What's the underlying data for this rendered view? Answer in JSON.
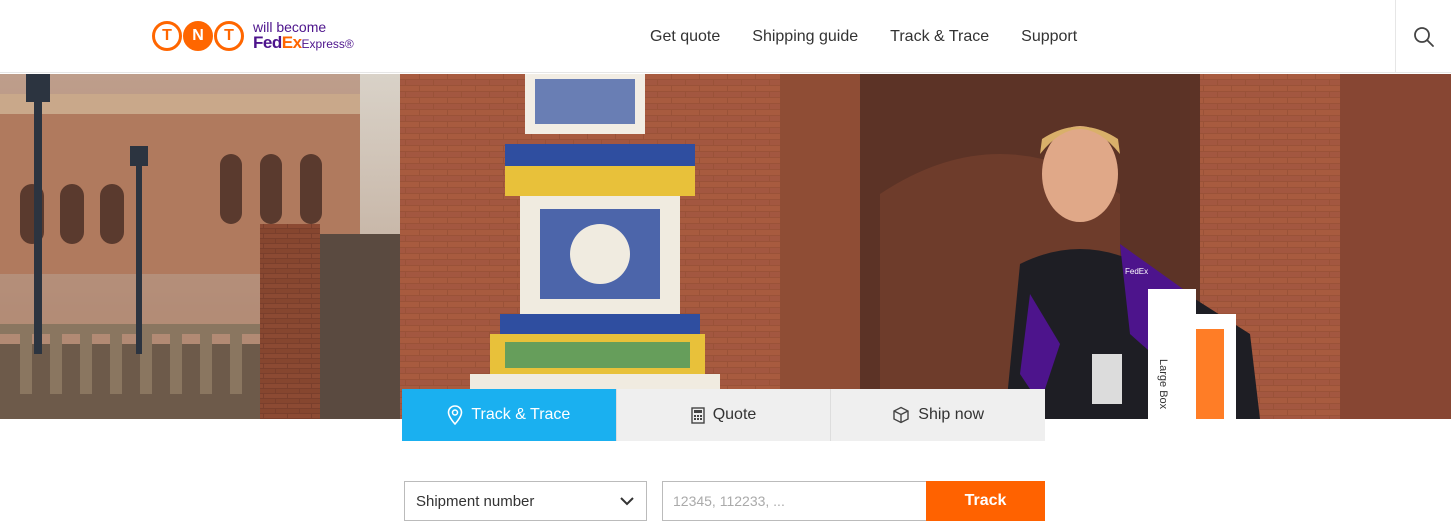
{
  "brand": {
    "tnt_letters": [
      "T",
      "N",
      "T"
    ],
    "tagline": "will become",
    "fedex_fed": "Fed",
    "fedex_ex": "Ex",
    "fedex_suffix": "Express",
    "reg": "®"
  },
  "nav": {
    "items": [
      {
        "label": "Get quote"
      },
      {
        "label": "Shipping guide"
      },
      {
        "label": "Track & Trace"
      },
      {
        "label": "Support"
      }
    ]
  },
  "hero": {
    "badge_label": "FedEx",
    "box_label": "Large Box"
  },
  "tabs": [
    {
      "label": "Track & Trace",
      "icon": "map-pin-icon",
      "active": true
    },
    {
      "label": "Quote",
      "icon": "calculator-icon",
      "active": false
    },
    {
      "label": "Ship now",
      "icon": "box-icon",
      "active": false
    }
  ],
  "form": {
    "select_value": "Shipment number",
    "input_placeholder": "12345, 112233, ...",
    "button_label": "Track"
  },
  "colors": {
    "tnt_orange": "#ff6600",
    "fedex_purple": "#4d148c",
    "tab_active": "#1ab0f0",
    "track_button": "#ff6200"
  }
}
